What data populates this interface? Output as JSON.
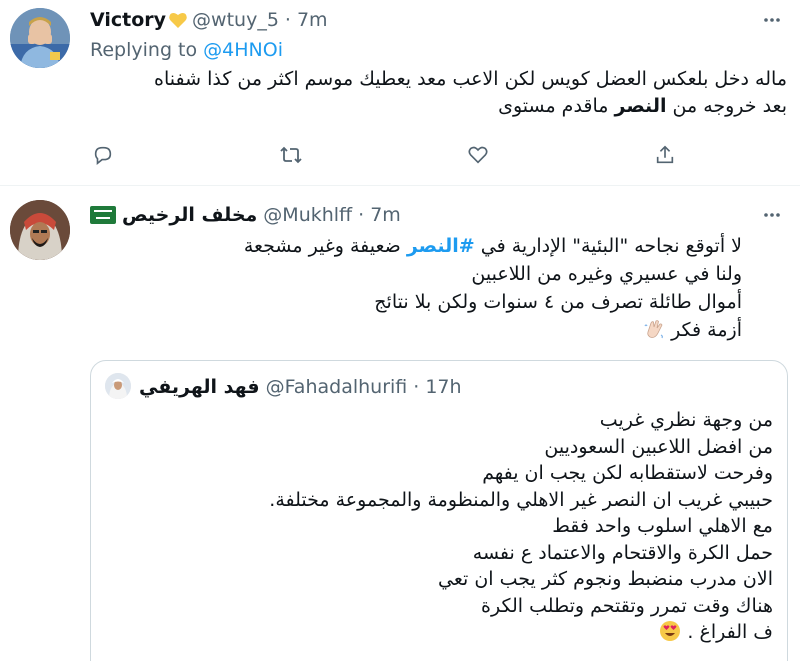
{
  "tweet1": {
    "display_name": "Victory",
    "handle": "@wtuy_5",
    "dot": "·",
    "time": "7m",
    "replying_prefix": "Replying to ",
    "replying_to": "@4HNOi",
    "line1": "ماله دخل بلعكس العضل كويس لكن الاعب معد يعطيك موسم اكثر من كذا شفناه",
    "line2_a": "بعد خروجه من ",
    "line2_bold": "النصر",
    "line2_b": " ماقدم مستوى",
    "icons": {
      "reply": "reply-icon",
      "retweet": "retweet-icon",
      "like": "heart-icon",
      "share": "share-icon",
      "more": "more-icon"
    }
  },
  "tweet2": {
    "display_name": "مخلف الرخيص",
    "handle": "@Mukhlff",
    "dot": "·",
    "time": "7m",
    "line1_a": "لا أتوقع نجاحه \"البئية\" الإدارية في ",
    "line1_hashtag": "#النصر",
    "line1_b": " ضعيفة وغير مشجعة",
    "line2": "ولنا في عسيري وغيره من اللاعبين",
    "line3": "أموال طائلة تصرف من ٤ سنوات ولكن بلا نتائج",
    "line4": "أزمة فكر"
  },
  "quote": {
    "display_name": "فهد الهريفي",
    "handle": "@Fahadalhurifi",
    "dot": "·",
    "time": "17h",
    "lines": [
      "من وجهة نظري غريب",
      "من افضل اللاعبين السعوديين",
      "وفرحت لاستقطابه لكن يجب ان يفهم",
      "حبيبي غريب ان النصر غير الاهلي والمنظومة والمجموعة مختلفة.",
      "مع الاهلي اسلوب واحد فقط",
      "حمل الكرة والاقتحام والاعتماد ع نفسه",
      "الان مدرب منضبط ونجوم كثر يجب ان تعي",
      "هناك وقت تمرر وتقتحم وتطلب الكرة",
      "ف الفراغ ."
    ]
  },
  "colors": {
    "link": "#1d9bf0",
    "secondary": "#536471",
    "border": "#cfd9de"
  }
}
